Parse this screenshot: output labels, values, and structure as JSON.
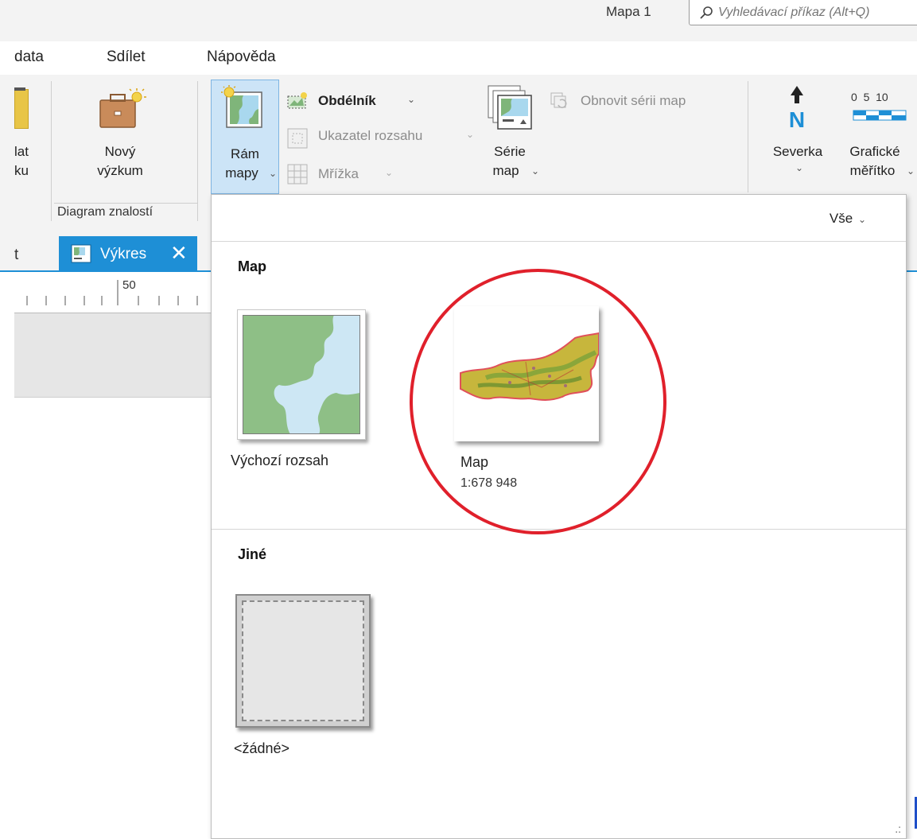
{
  "titlebar": {
    "doc_title": "Mapa 1",
    "search_placeholder": "Vyhledávací příkaz (Alt+Q)",
    "search_icon": "search-icon"
  },
  "menu_tabs": [
    "data",
    "Sdílet",
    "Nápověda"
  ],
  "ribbon": {
    "partial_button": {
      "label_line1": "lat",
      "label_line2": "ku"
    },
    "new_research": {
      "label_line1": "Nový",
      "label_line2": "výzkum",
      "icon": "briefcase-icon"
    },
    "group_label": "Diagram znalostí",
    "map_frame": {
      "label_line1": "Rám",
      "label_line2": "mapy",
      "icon": "map-frame-icon"
    },
    "rectangle": {
      "label": "Obdélník",
      "icon": "rectangle-icon"
    },
    "extent_indicator": {
      "label": "Ukazatel rozsahu",
      "icon": "extent-indicator-icon"
    },
    "grid": {
      "label": "Mřížka",
      "icon": "grid-icon"
    },
    "map_series": {
      "label_line1": "Série",
      "label_line2": "map",
      "icon": "map-series-icon"
    },
    "refresh_series": {
      "label": "Obnovit sérii map",
      "icon": "refresh-series-icon"
    },
    "north_arrow": {
      "label": "Severka",
      "icon": "north-arrow-icon"
    },
    "scale_bar": {
      "label_line1": "Grafické",
      "label_line2": "měřítko",
      "tick_labels": "0  5  10",
      "icon": "scale-bar-icon"
    }
  },
  "doc_tabs": {
    "partial_tab": "t",
    "active_tab": "Výkres",
    "ruler_mark": "50"
  },
  "gallery": {
    "filter_label": "Vše",
    "sections": [
      {
        "title": "Map",
        "items": [
          {
            "label": "Výchozí rozsah",
            "sub": ""
          },
          {
            "label": "Map",
            "sub": "1:678 948"
          }
        ]
      },
      {
        "title": "Jiné",
        "items": [
          {
            "label": "<žádné>",
            "sub": ""
          }
        ]
      }
    ]
  },
  "colors": {
    "accent": "#1e8fd6",
    "selected_bg": "#cce4f7",
    "annotation_circle": "#e0202b",
    "ribbon_bg": "#f3f3f3"
  }
}
